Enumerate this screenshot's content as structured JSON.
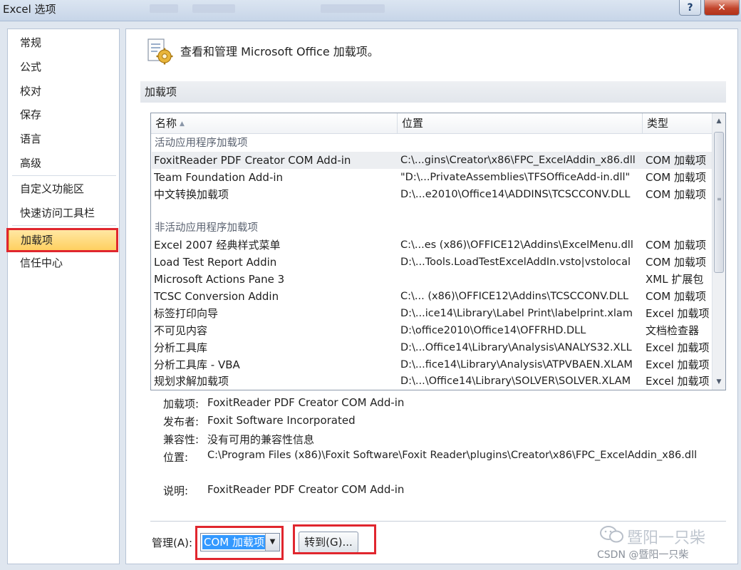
{
  "window": {
    "title": "Excel 选项",
    "help_label": "?",
    "close_label": "✕"
  },
  "nav": {
    "items": [
      {
        "label": "常规"
      },
      {
        "label": "公式"
      },
      {
        "label": "校对"
      },
      {
        "label": "保存"
      },
      {
        "label": "语言"
      },
      {
        "label": "高级"
      },
      {
        "label": "自定义功能区"
      },
      {
        "label": "快速访问工具栏"
      },
      {
        "label": "加载项"
      },
      {
        "label": "信任中心"
      }
    ],
    "selected": "加载项"
  },
  "header": {
    "text": "查看和管理 Microsoft Office 加载项。",
    "icon": "addins-gear-icon"
  },
  "section": {
    "title": "加载项"
  },
  "list": {
    "columns": {
      "name": "名称",
      "name_sort": "▲",
      "location": "位置",
      "type": "类型"
    },
    "groups": [
      {
        "title": "活动应用程序加载项",
        "rows": [
          {
            "name": "FoxitReader PDF Creator COM Add-in",
            "location": "C:\\...gins\\Creator\\x86\\FPC_ExcelAddin_x86.dll",
            "type": "COM 加载项",
            "selected": true
          },
          {
            "name": "Team Foundation Add-in",
            "location": "\"D:\\...PrivateAssemblies\\TFSOfficeAdd-in.dll\"",
            "type": "COM 加载项"
          },
          {
            "name": "中文转换加载项",
            "location": "D:\\...e2010\\Office14\\ADDINS\\TCSCCONV.DLL",
            "type": "COM 加载项"
          }
        ]
      },
      {
        "title": "非活动应用程序加载项",
        "rows": [
          {
            "name": "Excel 2007 经典样式菜单",
            "location": "C:\\...es (x86)\\OFFICE12\\Addins\\ExcelMenu.dll",
            "type": "COM 加载项"
          },
          {
            "name": "Load Test Report Addin",
            "location": "D:\\...Tools.LoadTestExcelAddIn.vsto|vstolocal",
            "type": "COM 加载项"
          },
          {
            "name": "Microsoft Actions Pane 3",
            "location": "",
            "type": "XML 扩展包"
          },
          {
            "name": "TCSC Conversion Addin",
            "location": "C:\\... (x86)\\OFFICE12\\Addins\\TCSCCONV.DLL",
            "type": "COM 加载项"
          },
          {
            "name": "标签打印向导",
            "location": "D:\\...ice14\\Library\\Label Print\\labelprint.xlam",
            "type": "Excel 加载项"
          },
          {
            "name": "不可见内容",
            "location": "D:\\office2010\\Office14\\OFFRHD.DLL",
            "type": "文档检查器"
          },
          {
            "name": "分析工具库",
            "location": "D:\\...Office14\\Library\\Analysis\\ANALYS32.XLL",
            "type": "Excel 加载项"
          },
          {
            "name": "分析工具库 - VBA",
            "location": "D:\\...fice14\\Library\\Analysis\\ATPVBAEN.XLAM",
            "type": "Excel 加载项"
          },
          {
            "name": "规划求解加载项",
            "location": "D:\\...\\Office14\\Library\\SOLVER\\SOLVER.XLAM",
            "type": "Excel 加载项"
          }
        ]
      }
    ]
  },
  "details": {
    "addin_label": "加载项:",
    "addin_value": "FoxitReader PDF Creator COM Add-in",
    "publisher_label": "发布者:",
    "publisher_value": "Foxit Software Incorporated",
    "compat_label": "兼容性:",
    "compat_value": "没有可用的兼容性信息",
    "location_label": "位置:",
    "location_value": "C:\\Program Files (x86)\\Foxit Software\\Foxit Reader\\plugins\\Creator\\x86\\FPC_ExcelAddin_x86.dll",
    "desc_label": "说明:",
    "desc_value": "FoxitReader PDF Creator COM Add-in"
  },
  "manage": {
    "label": "管理(A):",
    "selected_value": "COM 加载项",
    "goto_label": "转到(G)..."
  },
  "watermark": {
    "line1": "暨阳一只柴",
    "line2": "CSDN @暨阳一只柴"
  },
  "colors": {
    "highlight_red": "#e0262e",
    "nav_selected": "#ffd060",
    "select_blue": "#3399ff"
  }
}
